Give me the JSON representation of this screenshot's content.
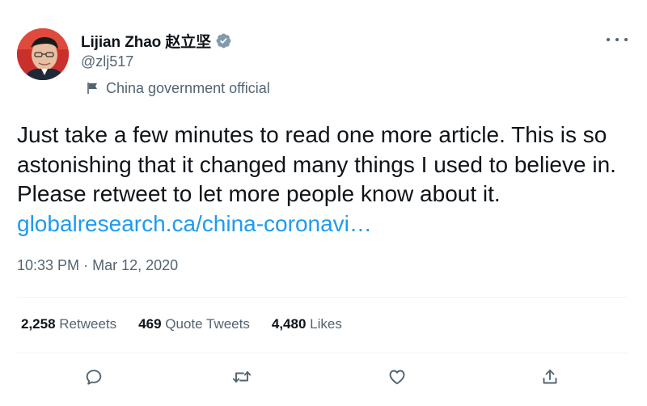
{
  "author": {
    "display_name": "Lijian Zhao 赵立坚",
    "handle": "@zlj517",
    "label": "China government official"
  },
  "tweet": {
    "text": "Just take a few minutes to read one more article. This is so astonishing that it changed many things I used to believe in. Please retweet to let more people know about it.",
    "link_text": "globalresearch.ca/china-coronavi…",
    "time": "10:33 PM",
    "separator": "·",
    "date": "Mar 12, 2020"
  },
  "stats": {
    "retweets_count": "2,258",
    "retweets_label": "Retweets",
    "quotes_count": "469",
    "quotes_label": "Quote Tweets",
    "likes_count": "4,480",
    "likes_label": "Likes"
  },
  "icons": {
    "more": "more-icon",
    "verified": "verified-badge-icon",
    "label": "flag-icon",
    "reply": "reply-icon",
    "retweet": "retweet-icon",
    "like": "like-icon",
    "share": "share-icon"
  },
  "colors": {
    "link": "#1d9bf0",
    "secondary_text": "#536471",
    "primary_text": "#0f1419",
    "divider": "#eff3f4"
  }
}
